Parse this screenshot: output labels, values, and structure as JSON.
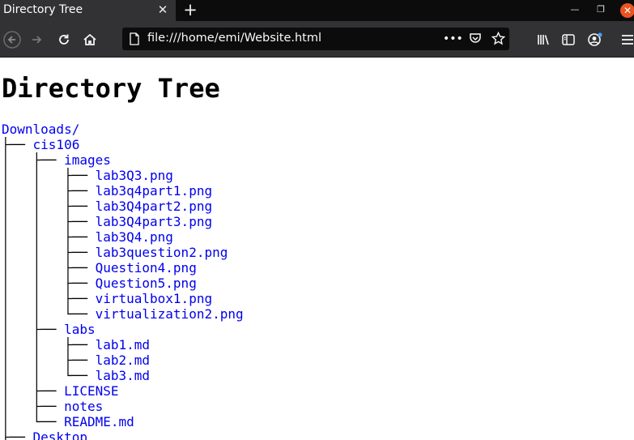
{
  "browser": {
    "tab_title": "Directory Tree",
    "tab_close_icon": "close-icon",
    "new_tab_symbol": "+",
    "url": "file:///home/emi/Website.html",
    "page_actions_symbol": "•••"
  },
  "page": {
    "title": "Directory Tree",
    "link_color": "#0000ee",
    "tree": [
      {
        "prefix": "",
        "name": "Downloads/"
      },
      {
        "prefix": "├── ",
        "name": "cis106"
      },
      {
        "prefix": "│   ├── ",
        "name": "images"
      },
      {
        "prefix": "│   │   ├── ",
        "name": "lab3Q3.png"
      },
      {
        "prefix": "│   │   ├── ",
        "name": "lab3q4part1.png"
      },
      {
        "prefix": "│   │   ├── ",
        "name": "lab3Q4part2.png"
      },
      {
        "prefix": "│   │   ├── ",
        "name": "lab3Q4part3.png"
      },
      {
        "prefix": "│   │   ├── ",
        "name": "lab3Q4.png"
      },
      {
        "prefix": "│   │   ├── ",
        "name": "lab3question2.png"
      },
      {
        "prefix": "│   │   ├── ",
        "name": "Question4.png"
      },
      {
        "prefix": "│   │   ├── ",
        "name": "Question5.png"
      },
      {
        "prefix": "│   │   ├── ",
        "name": "virtualbox1.png"
      },
      {
        "prefix": "│   │   └── ",
        "name": "virtualization2.png"
      },
      {
        "prefix": "│   ├── ",
        "name": "labs"
      },
      {
        "prefix": "│   │   ├── ",
        "name": "lab1.md"
      },
      {
        "prefix": "│   │   ├── ",
        "name": "lab2.md"
      },
      {
        "prefix": "│   │   └── ",
        "name": "lab3.md"
      },
      {
        "prefix": "│   ├── ",
        "name": "LICENSE"
      },
      {
        "prefix": "│   ├── ",
        "name": "notes"
      },
      {
        "prefix": "│   └── ",
        "name": "README.md"
      },
      {
        "prefix": "├── ",
        "name": "Desktop"
      }
    ]
  }
}
